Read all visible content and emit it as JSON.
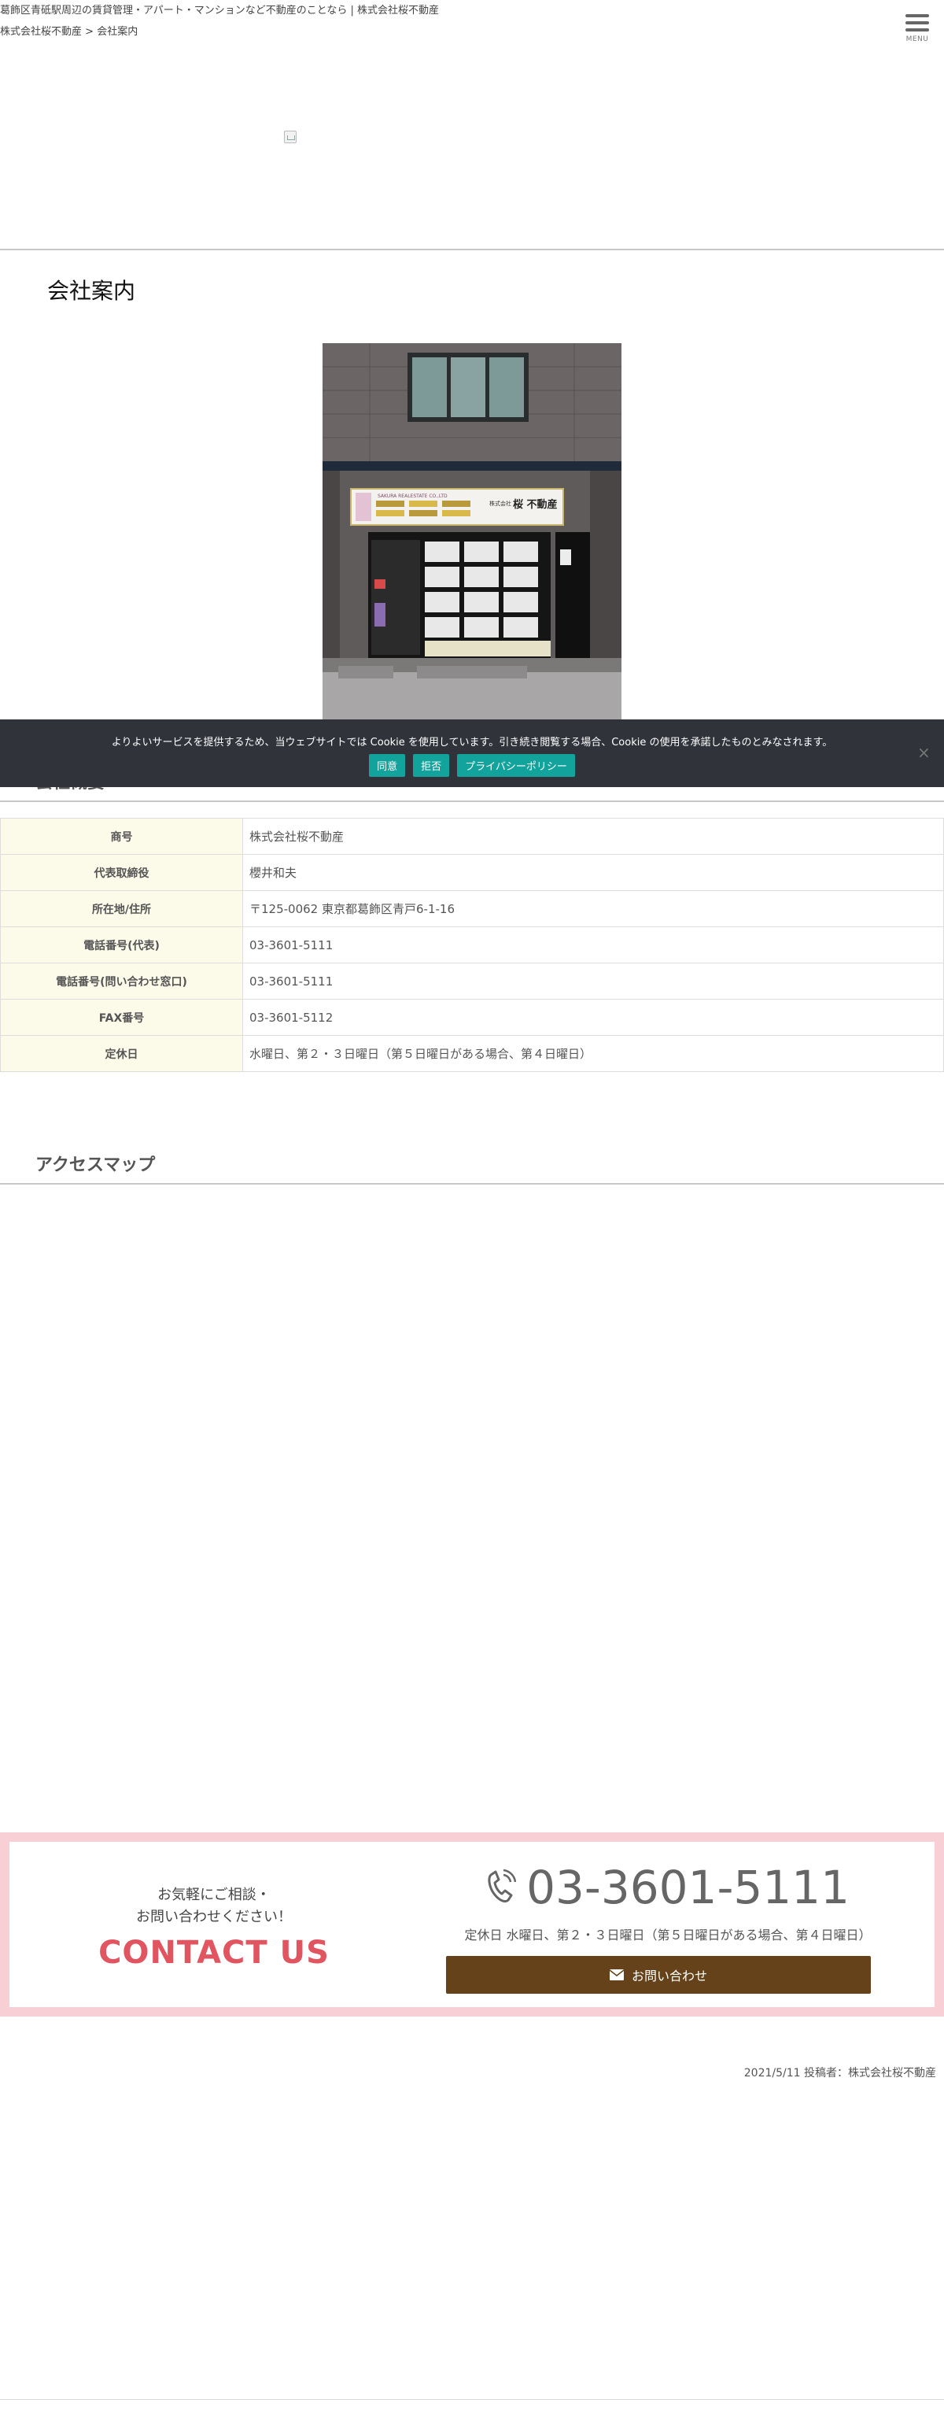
{
  "header": {
    "tagline": "葛飾区青砥駅周辺の賃貸管理・アパート・マンションなど不動産のことなら | 株式会社桜不動産",
    "menu_label": "MENU"
  },
  "breadcrumb": {
    "home": "株式会社桜不動産",
    "separator": " > ",
    "current": "会社案内"
  },
  "page_title": "会社案内",
  "storefront_sign": {
    "line1": "SAKURA REALESTATE CO.,LTD",
    "line2": "株式会社",
    "line3": "桜 不動産"
  },
  "company": {
    "heading": "会社概要",
    "rows": [
      {
        "label": "商号",
        "value": "株式会社桜不動産"
      },
      {
        "label": "代表取締役",
        "value": "櫻井和夫"
      },
      {
        "label": "所在地/住所",
        "value": "〒125-0062 東京都葛飾区青戸6-1-16"
      },
      {
        "label": "電話番号(代表)",
        "value": "03-3601-5111"
      },
      {
        "label": "電話番号(問い合わせ窓口)",
        "value": "03-3601-5111"
      },
      {
        "label": "FAX番号",
        "value": "03-3601-5112"
      },
      {
        "label": "定休日",
        "value": "水曜日、第２・３日曜日（第５日曜日がある場合、第４日曜日）"
      }
    ]
  },
  "access": {
    "heading": "アクセスマップ"
  },
  "cookie": {
    "message": "よりよいサービスを提供するため、当ウェブサイトでは Cookie を使用しています。引き続き閲覧する場合、Cookie の使用を承諾したものとみなされます。",
    "accept": "同意",
    "reject": "拒否",
    "privacy": "プライバシーポリシー",
    "close": "×"
  },
  "contact": {
    "lead_line1": "お気軽にご相談・",
    "lead_line2": "お問い合わせください！",
    "title": "CONTACT US",
    "phone": "03-3601-5111",
    "hours": "定休日 水曜日、第２・３日曜日（第５日曜日がある場合、第４日曜日）",
    "button": "お問い合わせ"
  },
  "post_meta": "2021/5/11 投稿者：株式会社桜不動産",
  "colors": {
    "accent_pink": "#e0555f",
    "frame_pink": "#f7cfd4",
    "button_brown": "#654219",
    "cookie_bg": "#30333a",
    "cookie_button": "#12a39c",
    "table_label_bg": "#fcfbea"
  }
}
